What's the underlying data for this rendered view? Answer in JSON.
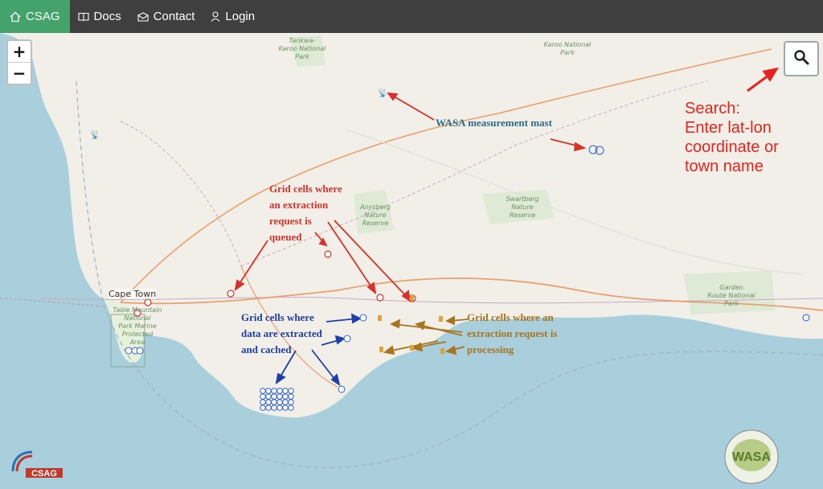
{
  "nav": {
    "brand": "CSAG",
    "items": [
      {
        "label": "Docs",
        "icon": "book-icon"
      },
      {
        "label": "Contact",
        "icon": "envelope-icon"
      },
      {
        "label": "Login",
        "icon": "user-icon"
      }
    ]
  },
  "map": {
    "zoom_in": "+",
    "zoom_out": "−",
    "places": {
      "tankwa": "Tankwa-\nKaroo National\nPark",
      "karoo": "Karoo National\nPark",
      "anysberg": "Anysberg\nNature\nReserve",
      "swartberg": "Swartberg\nNature\nReserve",
      "garden_route": "Garden\nRoute National\nPark",
      "table_mountain": "Table Mountain\nNational\nPark Marine\nProtected\nArea",
      "cape_town": "Cape Town"
    }
  },
  "annotations": {
    "search_hint": "Search:\nEnter lat-lon\ncoordinate or\ntown name",
    "mast": "WASA measurement mast",
    "queued": "Grid cells where\nan extraction\nrequest is\nqueued",
    "cached": "Grid cells where\ndata are extracted\nand cached",
    "processing": "Grid cells where an\nextraction request is\nprocessing"
  },
  "logos": {
    "csag": "CSAG",
    "wasa": "WASA"
  },
  "colors": {
    "nav_bg": "#3f3f3f",
    "brand_bg": "#43a36b",
    "queued": "#d8312a",
    "cached": "#1c3fa8",
    "processing": "#a8741e",
    "mast_label": "#2e6b86",
    "hint": "#e8231d"
  }
}
